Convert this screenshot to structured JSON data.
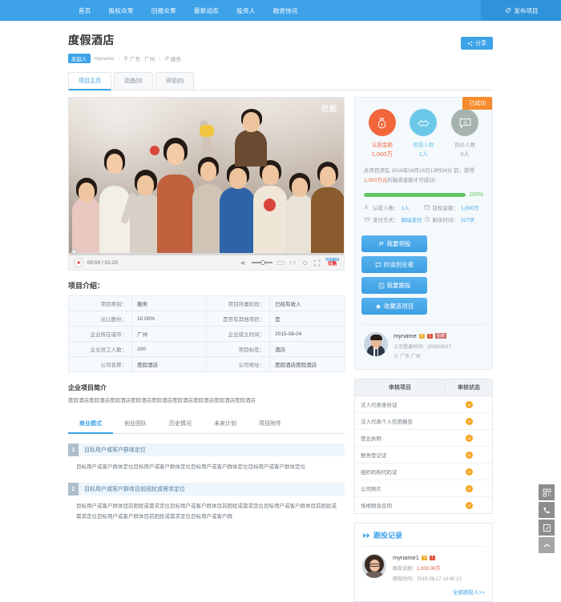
{
  "nav": {
    "items": [
      {
        "label": "首页"
      },
      {
        "label": "股权众筹"
      },
      {
        "label": "回报众筹"
      },
      {
        "label": "最新动态"
      },
      {
        "label": "投资人"
      },
      {
        "label": "融资快讯"
      }
    ],
    "publish_label": "发布项目"
  },
  "header": {
    "project_title": "度假酒店",
    "share_label": "分享",
    "badge_launcher": "发起人",
    "owner_name": "myname",
    "province": "广东",
    "city": "广州",
    "category": "服务",
    "tabs": [
      {
        "label": "项目主页",
        "active": true
      },
      {
        "label": "动态(0)",
        "active": false
      },
      {
        "label": "评论(0)",
        "active": false
      }
    ]
  },
  "video": {
    "watermark": "优酷",
    "current_time": "00:00",
    "total_time": "01:20",
    "time_display": "00:00 / 01:20",
    "logo_top": "YOUKU",
    "logo_bottom": "优酷"
  },
  "intro": {
    "section_title": "项目介绍：",
    "rows": [
      {
        "l1": "项目类别：",
        "v1": "服务",
        "l2": "项目所属阶段：",
        "v2": "已经有收入"
      },
      {
        "l1": "出让股份：",
        "v1": "10.00%",
        "l2": "是否有其他项目：",
        "v2": "是"
      },
      {
        "l1": "企业所在城市：",
        "v1": "广州",
        "l2": "企业成立时间：",
        "v2": "2015-08-04"
      },
      {
        "l1": "企业员工人数：",
        "v1": "200",
        "l2": "项目标签：",
        "v2": "酒店"
      },
      {
        "l1": "公司名称：",
        "v1": "度假酒店",
        "l2": "公司地址：",
        "v2": "度假酒店度假酒店"
      }
    ]
  },
  "brief": {
    "title": "企业项目简介",
    "text": "度假酒店度假酒店度假酒店度假酒店度假酒店度假酒店度假酒店度假酒店度假酒店"
  },
  "section_tabs": [
    {
      "label": "商业模式",
      "active": true
    },
    {
      "label": "创业团队",
      "active": false
    },
    {
      "label": "历史情况",
      "active": false
    },
    {
      "label": "未来计划",
      "active": false
    },
    {
      "label": "项目附件",
      "active": false
    }
  ],
  "blocks": [
    {
      "num": "1",
      "title": "目标用户或客户群体定位",
      "body": "目标用户或客户群体定位目标用户或客户群体定位目标用户或客户群体定位目标用户或客户群体定位"
    },
    {
      "num": "2",
      "title": "目标用户或客户群体目前困扰或需求定位",
      "body": "目标用户或客户群体目前困扰或需求定位目标用户或客户群体目前困扰或需求定位目标用户或客户群体目前困扰或需求定位目标用户或客户群体目前困扰或需求定位目标用户或客户群"
    }
  ],
  "stats": {
    "success_badge": "已成功",
    "items": [
      {
        "icon": "money-bag-icon",
        "label": "认投金额",
        "value": "1,000万",
        "color": "#f2663c"
      },
      {
        "icon": "handshake-icon",
        "label": "限投人数",
        "value": "1人",
        "color": "#6cc8e8"
      },
      {
        "icon": "price-chat-icon",
        "label": "询价人数",
        "value": "0人",
        "color": "#a6b2ae"
      }
    ],
    "deadline_prefix": "此项目须在",
    "deadline_date": "2016年04月16日13时34分",
    "deadline_mid": "前，获得",
    "deadline_amount": "1,000万元",
    "deadline_suffix": "的融资金额才可成功!",
    "progress_percent": "100%",
    "progress_value": 100,
    "kv": [
      {
        "icon": "people-icon",
        "label": "认投人数：",
        "value": "1人"
      },
      {
        "icon": "target-icon",
        "label": "目标金额：",
        "value": "1,000万"
      },
      {
        "icon": "card-icon",
        "label": "支付方式：",
        "value": "网站支付"
      },
      {
        "icon": "clock-icon",
        "label": "剩余时间：",
        "value": "227天"
      }
    ]
  },
  "actions": [
    {
      "icon": "flag-icon",
      "label": "我要领投"
    },
    {
      "icon": "chat-icon",
      "label": "约谈创业者"
    },
    {
      "icon": "follow-icon",
      "label": "我要跟投"
    },
    {
      "icon": "star-icon",
      "label": "收藏该项目"
    }
  ],
  "owner_card": {
    "name": "myname",
    "tag_verified": "V",
    "tag_risk": "1",
    "tag_sticky": "贴牌",
    "last_login_label": "上次登录时间：",
    "last_login_value": "2015/08/17",
    "location": "广东 广州"
  },
  "audit": {
    "col1": "审核项目",
    "col2": "审核状态",
    "rows": [
      {
        "name": "法人代表身份证",
        "status": "通过"
      },
      {
        "name": "法人代表个人信用报告",
        "status": "通过"
      },
      {
        "name": "营业执照",
        "status": "通过"
      },
      {
        "name": "税务登记证",
        "status": "通过"
      },
      {
        "name": "组织机构代码证",
        "status": "通过"
      },
      {
        "name": "公司照片",
        "status": "通过"
      },
      {
        "name": "场地租赁合同",
        "status": "通过"
      }
    ]
  },
  "follow": {
    "title": "跟投记录",
    "investor_name": "myname1",
    "tag_verified": "V",
    "tag_level": "1",
    "amount_label": "跟投金额：",
    "amount_value": "1,000.00万",
    "time_label": "跟投时间：",
    "time_value": "2015-08-17 13:45:13",
    "all_link": "全部跟投人>>"
  },
  "float_bar": [
    {
      "icon": "qrcode-icon",
      "name": "qrcode-button"
    },
    {
      "icon": "phone-icon",
      "name": "phone-button"
    },
    {
      "icon": "feedback-icon",
      "name": "feedback-button"
    },
    {
      "icon": "scroll-top-icon",
      "name": "scroll-top-button"
    }
  ]
}
